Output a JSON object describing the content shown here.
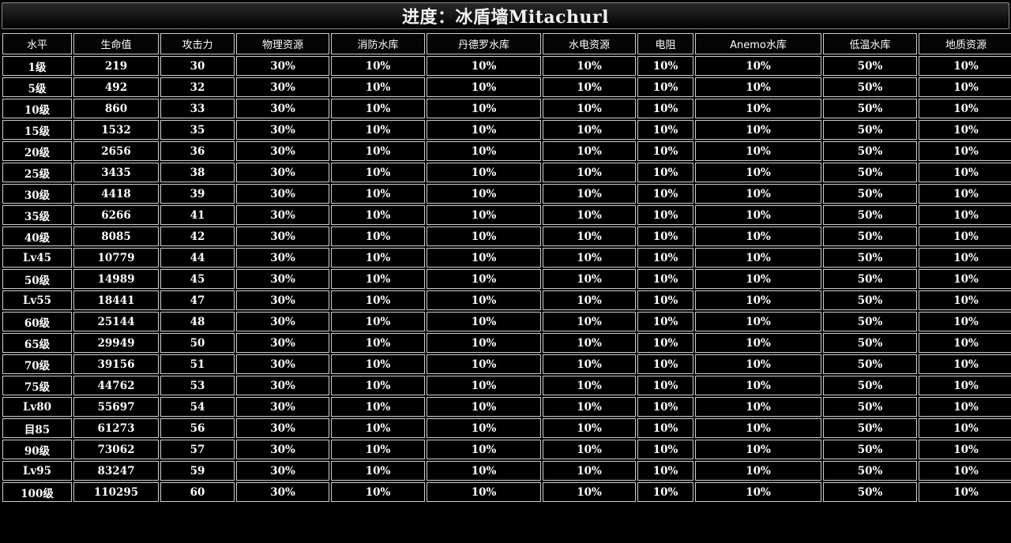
{
  "title": "进度：冰盾墙Mitachurl",
  "table": {
    "headers": [
      "水平",
      "生命值",
      "攻击力",
      "物理资源",
      "消防水库",
      "丹德罗水库",
      "水电资源",
      "电阻",
      "Anemo水库",
      "低温水库",
      "地质资源"
    ],
    "rows": [
      [
        "1级",
        "219",
        "30",
        "30%",
        "10%",
        "10%",
        "10%",
        "10%",
        "10%",
        "50%",
        "10%"
      ],
      [
        "5级",
        "492",
        "32",
        "30%",
        "10%",
        "10%",
        "10%",
        "10%",
        "10%",
        "50%",
        "10%"
      ],
      [
        "10级",
        "860",
        "33",
        "30%",
        "10%",
        "10%",
        "10%",
        "10%",
        "10%",
        "50%",
        "10%"
      ],
      [
        "15级",
        "1532",
        "35",
        "30%",
        "10%",
        "10%",
        "10%",
        "10%",
        "10%",
        "50%",
        "10%"
      ],
      [
        "20级",
        "2656",
        "36",
        "30%",
        "10%",
        "10%",
        "10%",
        "10%",
        "10%",
        "50%",
        "10%"
      ],
      [
        "25级",
        "3435",
        "38",
        "30%",
        "10%",
        "10%",
        "10%",
        "10%",
        "10%",
        "50%",
        "10%"
      ],
      [
        "30级",
        "4418",
        "39",
        "30%",
        "10%",
        "10%",
        "10%",
        "10%",
        "10%",
        "50%",
        "10%"
      ],
      [
        "35级",
        "6266",
        "41",
        "30%",
        "10%",
        "10%",
        "10%",
        "10%",
        "10%",
        "50%",
        "10%"
      ],
      [
        "40级",
        "8085",
        "42",
        "30%",
        "10%",
        "10%",
        "10%",
        "10%",
        "10%",
        "50%",
        "10%"
      ],
      [
        "Lv45",
        "10779",
        "44",
        "30%",
        "10%",
        "10%",
        "10%",
        "10%",
        "10%",
        "50%",
        "10%"
      ],
      [
        "50级",
        "14989",
        "45",
        "30%",
        "10%",
        "10%",
        "10%",
        "10%",
        "10%",
        "50%",
        "10%"
      ],
      [
        "Lv55",
        "18441",
        "47",
        "30%",
        "10%",
        "10%",
        "10%",
        "10%",
        "10%",
        "50%",
        "10%"
      ],
      [
        "60级",
        "25144",
        "48",
        "30%",
        "10%",
        "10%",
        "10%",
        "10%",
        "10%",
        "50%",
        "10%"
      ],
      [
        "65级",
        "29949",
        "50",
        "30%",
        "10%",
        "10%",
        "10%",
        "10%",
        "10%",
        "50%",
        "10%"
      ],
      [
        "70级",
        "39156",
        "51",
        "30%",
        "10%",
        "10%",
        "10%",
        "10%",
        "10%",
        "50%",
        "10%"
      ],
      [
        "75级",
        "44762",
        "53",
        "30%",
        "10%",
        "10%",
        "10%",
        "10%",
        "10%",
        "50%",
        "10%"
      ],
      [
        "Lv80",
        "55697",
        "54",
        "30%",
        "10%",
        "10%",
        "10%",
        "10%",
        "10%",
        "50%",
        "10%"
      ],
      [
        "目85",
        "61273",
        "56",
        "30%",
        "10%",
        "10%",
        "10%",
        "10%",
        "10%",
        "50%",
        "10%"
      ],
      [
        "90级",
        "73062",
        "57",
        "30%",
        "10%",
        "10%",
        "10%",
        "10%",
        "10%",
        "50%",
        "10%"
      ],
      [
        "Lv95",
        "83247",
        "59",
        "30%",
        "10%",
        "10%",
        "10%",
        "10%",
        "10%",
        "50%",
        "10%"
      ],
      [
        "100级",
        "110295",
        "60",
        "30%",
        "10%",
        "10%",
        "10%",
        "10%",
        "10%",
        "50%",
        "10%"
      ]
    ]
  }
}
